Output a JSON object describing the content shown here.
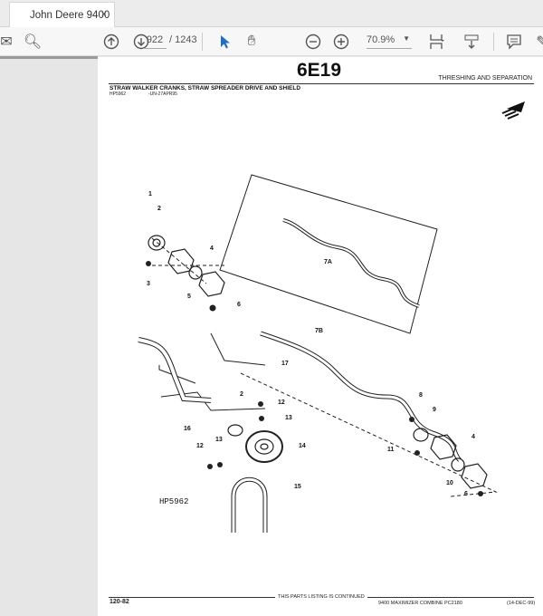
{
  "tab": {
    "title": "John Deere 9400 ...",
    "close": "×"
  },
  "toolbar": {
    "page_current": "922",
    "page_total": "/ 1243",
    "zoom": "70.9%"
  },
  "page": {
    "code": "6E19",
    "section": "THRESHING AND SEPARATION",
    "title": "STRAW WALKER CRANKS, STRAW SPREADER DRIVE AND SHIELD",
    "sub_id": "HP5962",
    "sub_code": "-UN-27APR95",
    "figure_id": "HP5962",
    "callouts": [
      "1",
      "2",
      "3",
      "4",
      "5",
      "6",
      "7A",
      "7B",
      "17",
      "8",
      "9",
      "11",
      "4",
      "10",
      "6",
      "16",
      "2",
      "12",
      "13",
      "14",
      "12",
      "13",
      "15"
    ],
    "footer_left": "120-82",
    "footer_center": "THIS PARTS LISTING IS CONTINUED",
    "footer_right": "9400 MAXIMIZER COMBINE   PC2180",
    "footer_date": "(14-DEC-99)"
  }
}
